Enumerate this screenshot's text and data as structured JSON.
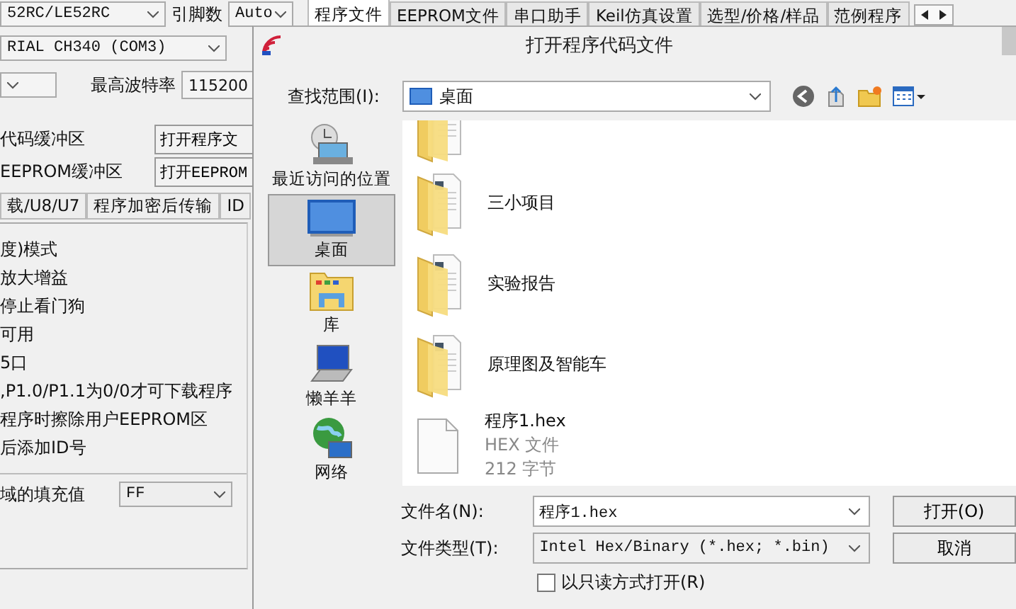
{
  "app": {
    "chip_select": "52RC/LE52RC",
    "pin_label": "引脚数",
    "pin_select": "Auto",
    "tabs": [
      {
        "label": "程序文件",
        "selected": true
      },
      {
        "label": "EEPROM文件",
        "selected": false
      },
      {
        "label": "串口助手",
        "selected": false
      },
      {
        "label": "Keil仿真设置",
        "selected": false
      },
      {
        "label": "选型/价格/样品",
        "selected": false
      },
      {
        "label": "范例程序",
        "selected": false
      }
    ],
    "port_select": "RIAL CH340 (COM3)",
    "max_baud_label": "最高波特率",
    "max_baud_value": "115200",
    "buffers": [
      {
        "label": "代码缓冲区",
        "button": "打开程序文"
      },
      {
        "label": "EEPROM缓冲区",
        "button": "打开EEPROM"
      }
    ],
    "sub_tabs": [
      {
        "label": "载/U8/U7",
        "selected": false
      },
      {
        "label": "程序加密后传输",
        "selected": false
      },
      {
        "label": "ID",
        "selected": false
      }
    ],
    "options": [
      "度)模式",
      "放大增益",
      "停止看门狗",
      "可用",
      "5口",
      ",P1.0/P1.1为0/0才可下载程序",
      "程序时擦除用户EEPROM区",
      "后添加ID号"
    ],
    "fill_label": "域的填充值",
    "fill_value": "FF"
  },
  "dialog": {
    "title": "打开程序代码文件",
    "look_in_label": "查找范围(I):",
    "look_in_value": "桌面",
    "places": [
      {
        "kind": "recent",
        "label": "最近访问的位置",
        "selected": false
      },
      {
        "kind": "desktop",
        "label": "桌面",
        "selected": true
      },
      {
        "kind": "library",
        "label": "库",
        "selected": false
      },
      {
        "kind": "user",
        "label": "懒羊羊",
        "selected": false
      },
      {
        "kind": "network",
        "label": "网络",
        "selected": false
      }
    ],
    "files": [
      {
        "kind": "folder"
      },
      {
        "kind": "folder",
        "name": "三小项目"
      },
      {
        "kind": "folder",
        "name": "实验报告"
      },
      {
        "kind": "folder",
        "name": "原理图及智能车"
      },
      {
        "kind": "file",
        "name": "程序1.hex",
        "type": "HEX 文件",
        "size": "212 字节"
      }
    ],
    "file_name_label": "文件名(N):",
    "file_name_value": "程序1.hex",
    "open_button": "打开(O)",
    "file_type_label": "文件类型(T):",
    "file_type_value": "Intel Hex/Binary (*.hex; *.bin)",
    "cancel_button": "取消",
    "read_only_label": "以只读方式打开(R)",
    "read_only": false
  }
}
